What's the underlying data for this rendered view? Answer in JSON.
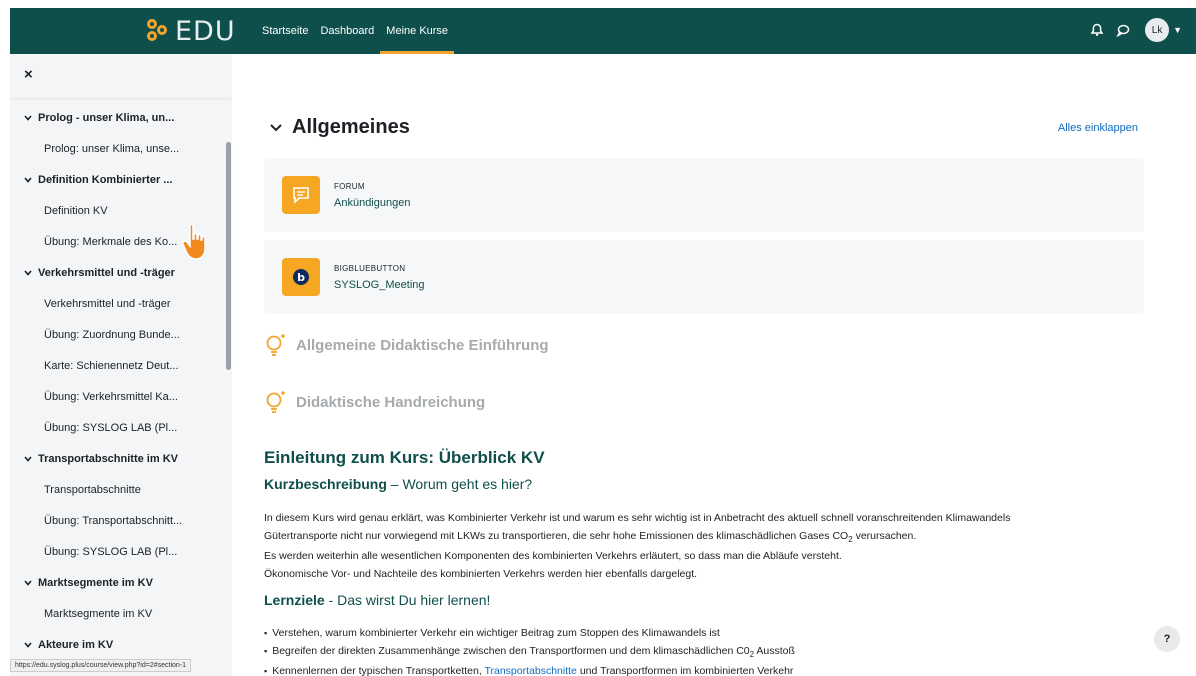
{
  "brand": {
    "logo_text": "EDU",
    "accent": "#f4a42b",
    "navbar_color": "#0f4f4b"
  },
  "nav": {
    "links": [
      "Startseite",
      "Dashboard",
      "Meine Kurse"
    ],
    "active": "Meine Kurse",
    "avatar_initials": "Lk"
  },
  "drawer": {
    "close_symbol": "×",
    "items": [
      {
        "type": "section",
        "label": "Prolog - unser Klima, un..."
      },
      {
        "type": "link",
        "label": "Prolog: unser Klima, unse..."
      },
      {
        "type": "section",
        "label": "Definition Kombinierter ..."
      },
      {
        "type": "link",
        "label": "Definition KV"
      },
      {
        "type": "link",
        "label": "Übung: Merkmale des Ko..."
      },
      {
        "type": "section",
        "label": "Verkehrsmittel und -träger"
      },
      {
        "type": "link",
        "label": "Verkehrsmittel und -träger"
      },
      {
        "type": "link",
        "label": "Übung: Zuordnung Bunde..."
      },
      {
        "type": "link",
        "label": "Karte: Schienennetz Deut..."
      },
      {
        "type": "link",
        "label": "Übung: Verkehrsmittel Ka..."
      },
      {
        "type": "link",
        "label": "Übung: SYSLOG LAB (Pl..."
      },
      {
        "type": "section",
        "label": "Transportabschnitte im KV"
      },
      {
        "type": "link",
        "label": "Transportabschnitte"
      },
      {
        "type": "link",
        "label": "Übung: Transportabschnitt..."
      },
      {
        "type": "link",
        "label": "Übung: SYSLOG LAB (Pl..."
      },
      {
        "type": "section",
        "label": "Marktsegmente im KV"
      },
      {
        "type": "link",
        "label": "Marktsegmente im KV"
      },
      {
        "type": "section",
        "label": "Akteure im KV"
      }
    ],
    "status_url": "https://edu.syslog.plus/course/view.php?id=2#section-1"
  },
  "main": {
    "section_title": "Allgemeines",
    "collapse_all": "Alles einklappen",
    "activities": [
      {
        "type": "FORUM",
        "name": "Ankündigungen",
        "icon": "forum-icon"
      },
      {
        "type": "BIGBLUEBUTTON",
        "name": "SYSLOG_Meeting",
        "icon": "bigbluebutton-icon"
      }
    ],
    "labels": [
      "Allgemeine Didaktische Einführung",
      "Didaktische Handreichung"
    ],
    "intro_heading": "Einleitung zum Kurs: Überblick KV",
    "kurz_bold": "Kurzbeschreibung",
    "kurz_rest": " – Worum geht es hier?",
    "para_lines": [
      "In diesem Kurs wird genau erklärt, was Kombinierter Verkehr ist und warum es sehr wichtig ist in Anbetracht des aktuell schnell voranschreitenden Klimawandels",
      "Gütertransporte nicht nur vorwiegend mit LKWs zu transportieren, die sehr hohe Emissionen des klimaschädlichen Gases CO",
      "Es werden weiterhin alle wesentlichen Komponenten des kombinierten Verkehrs erläutert, so dass man die Abläufe versteht.",
      "Ökonomische Vor- und Nachteile des kombinierten Verkehrs werden hier ebenfalls dargelegt."
    ],
    "co2_sub": "2",
    "co2_tail": " verursachen.",
    "lernziele_bold": "Lernziele",
    "lernziele_rest": " - Das wirst Du hier lernen!",
    "bullet1": "Verstehen, warum kombinierter Verkehr ein wichtiger Beitrag zum Stoppen des Klimawandels ist",
    "bullet2_a": "Begreifen der direkten Zusammenhänge zwischen den Transportformen und dem klimaschädlichen C0",
    "bullet2_sub": "2",
    "bullet2_b": " Ausstoß",
    "bullet3_a": "Kennenlernen der typischen Transportketten, ",
    "bullet3_link": "Transportabschnitte",
    "bullet3_b": " und Transportformen im kombinierten Verkehr",
    "help": "?"
  }
}
